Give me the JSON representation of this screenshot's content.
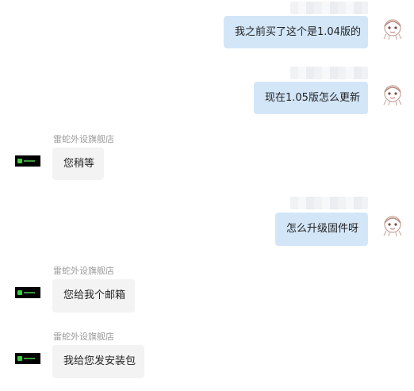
{
  "messages": [
    {
      "side": "out",
      "text": "我之前买了这个是1.04版的"
    },
    {
      "side": "out",
      "text": "现在1.05版怎么更新"
    },
    {
      "side": "in",
      "sender": "雷蛇外设旗舰店",
      "text": "您稍等"
    },
    {
      "side": "out",
      "text": "怎么升级固件呀"
    },
    {
      "side": "in",
      "sender": "雷蛇外设旗舰店",
      "text": "您给我个邮箱"
    },
    {
      "side": "in",
      "sender": "雷蛇外设旗舰店",
      "text": "我给您发安装包"
    }
  ],
  "colors": {
    "out_bubble": "#d3e6f8",
    "in_bubble": "#f3f3f3",
    "shop_logo": "#3ccf3c"
  },
  "icons": {
    "me_avatar": "cartoon-avatar-icon",
    "shop_avatar": "razer-logo-icon"
  }
}
